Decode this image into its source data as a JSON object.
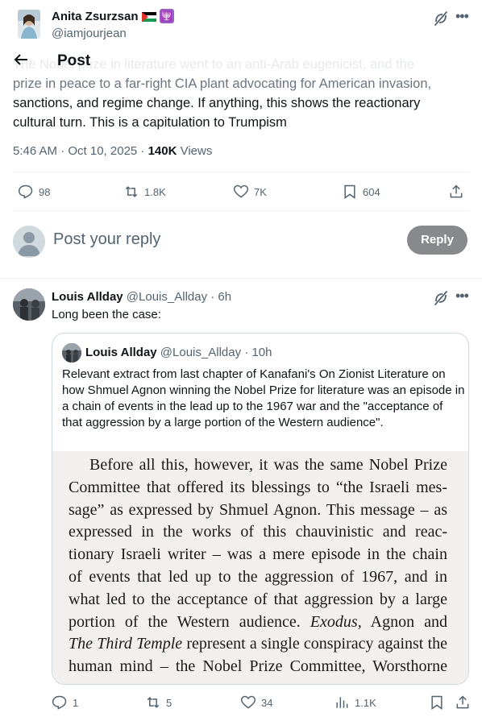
{
  "main_post": {
    "author_name": "Anita Zsurzsan",
    "author_handle": "@iamjourjean",
    "header_title": "Post",
    "text_lines": [
      "The Nobel prize in literature went to an anti-Arab eugenicist, and the",
      "prize in peace to a far-right CIA plant advocating for American invasion,",
      "sanctions, and regime change. If anything, this shows the reactionary",
      "cultural turn. This is a capitulation to Trumpism"
    ],
    "timestamp": "5:46 AM · Oct 10, 2025 · ",
    "views_count": "140K",
    "views_label": " Views",
    "stats": {
      "replies": "98",
      "reposts": "1.8K",
      "likes": "7K",
      "bookmarks": "604"
    }
  },
  "reply_box": {
    "placeholder": "Post your reply",
    "button_label": "Reply"
  },
  "reply": {
    "author_name": "Louis Allday",
    "author_handle": "@Louis_Allday",
    "time": " · 6h",
    "text": "Long been the case:",
    "stats": {
      "replies": "1",
      "reposts": "5",
      "likes": "34",
      "views": "1.1K"
    },
    "quote": {
      "author_name": "Louis Allday",
      "author_handle": "@Louis_Allday",
      "time": " · 10h",
      "text": "Relevant extract from last chapter of Kanafani's On Zionist Literature on how Shmuel Agnon winning the Nobel Prize for literature was an episode in a chain of events in the lead up to the 1967 war and the \"acceptance of that aggression by a large portion of the Western audience\".",
      "image_lines": [
        "Before all this, however, it was the same Nobel Prize",
        "Committee that offered its blessings to “the Israeli mes-",
        "sage” as expressed by Shmuel Agnon. This message – as",
        "expressed in the works of this chauvinistic and reac-",
        "tionary Israeli writer – was a mere episode in the chain",
        "of events that led up to the aggression of 1967, and in",
        "what led to the acceptance of that aggression by a large",
        "portion of the Western audience. Exodus, Agnon and",
        "The Third Temple represent a single conspiracy against the",
        "human mind – the Nobel Prize Committee, Worsthorne"
      ]
    }
  },
  "colors": {
    "text": "#0f1419",
    "secondary": "#536471",
    "border": "#eff3f4",
    "reply_button": "#87898c"
  }
}
